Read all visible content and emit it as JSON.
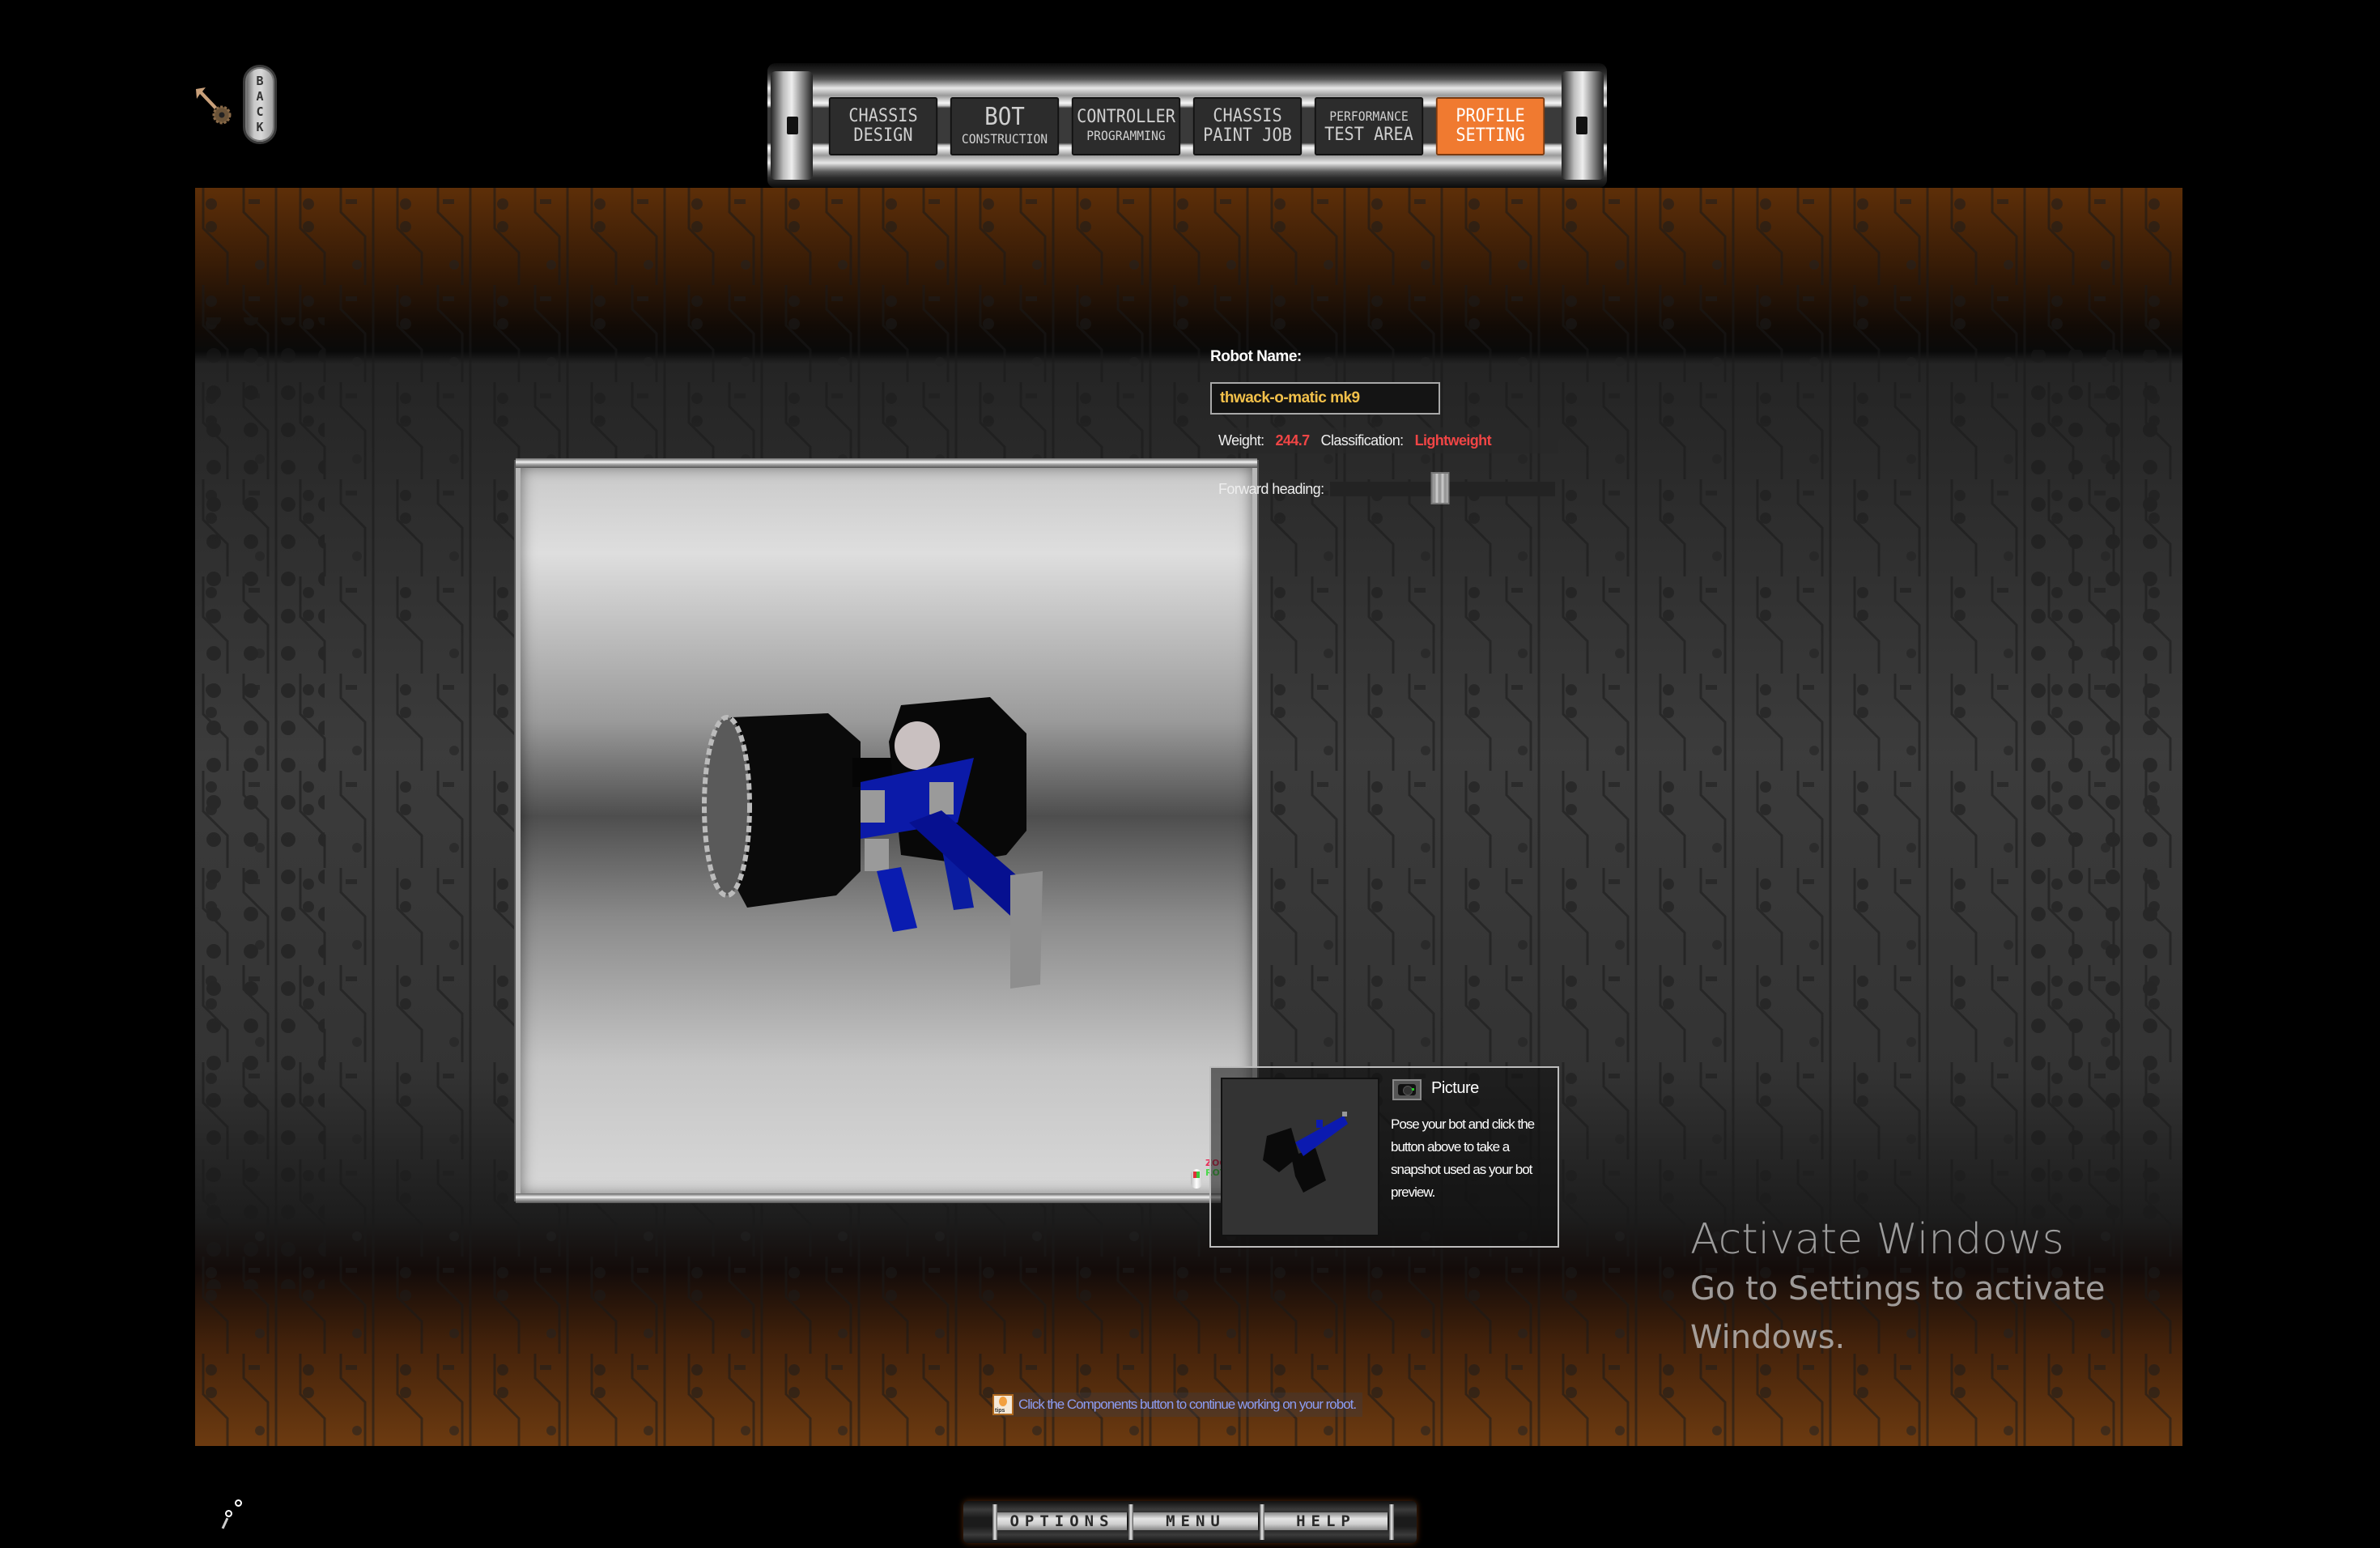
{
  "back_button": {
    "label_letters": [
      "B",
      "A",
      "C",
      "K"
    ]
  },
  "topnav": {
    "tabs": [
      {
        "id": "chassis-design",
        "line1": "CHASSIS",
        "line2": "DESIGN",
        "active": false
      },
      {
        "id": "bot-construction",
        "line1": "BOT",
        "line2": "CONSTRUCTION",
        "active": false
      },
      {
        "id": "controller-programming",
        "line1": "CONTROLLER",
        "line2": "PROGRAMMING",
        "active": false
      },
      {
        "id": "chassis-paint-job",
        "line1": "CHASSIS",
        "line2": "PAINT JOB",
        "active": false
      },
      {
        "id": "performance-test-area",
        "line1": "PERFORMANCE",
        "line2": "TEST AREA",
        "active": false
      },
      {
        "id": "profile-setting",
        "line1": "PROFILE",
        "line2": "SETTING",
        "active": true
      }
    ],
    "active_color": "#f07a30"
  },
  "viewport": {
    "hint_zoom": "ZOOM",
    "hint_rotate": "ROTATE",
    "hint_zoom_color": "#e8305a",
    "hint_rotate_color": "#4bd84b"
  },
  "profile": {
    "robot_name_label": "Robot Name:",
    "robot_name_value": "thwack-o-matic mk9",
    "weight_label": "Weight:",
    "weight_value": "244.7",
    "classification_label": "Classification:",
    "classification_value": "Lightweight",
    "forward_heading_label": "Forward heading:",
    "forward_heading_fraction": 0.49,
    "value_color": "#f04545",
    "name_color": "#f2c04a"
  },
  "picture_panel": {
    "title": "Picture",
    "camera_icon": "camera-icon",
    "description": "Pose your bot and click the button above to take a snapshot used as your bot preview."
  },
  "tip": {
    "icon": "tips-lightbulb-icon",
    "icon_text": "tips",
    "text": "Click the Components button to continue working on your robot."
  },
  "bottomnav": {
    "options_label": "OPTIONS",
    "menu_label": "MENU",
    "help_label": "HELP"
  },
  "windows_watermark": {
    "title": "Activate Windows",
    "subtitle": "Go to Settings to activate Windows."
  }
}
